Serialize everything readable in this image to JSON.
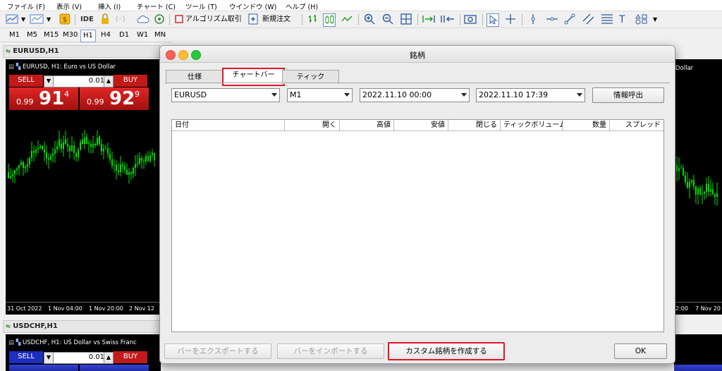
{
  "menu": [
    "ファイル (F)",
    "表示 (V)",
    "挿入 (I)",
    "チャート (C)",
    "ツール (T)",
    "ウインドウ (W)",
    "ヘルプ (H)"
  ],
  "toolbar": {
    "ide_label": "IDE",
    "algo_label": "アルゴリズム取引",
    "new_order_label": "新規注文"
  },
  "timeframes": [
    "M1",
    "M5",
    "M15",
    "M30",
    "H1",
    "H4",
    "D1",
    "W1",
    "MN"
  ],
  "active_timeframe": "H1",
  "charts": {
    "eurusd": {
      "window_title": "EURUSD,H1",
      "label": "EURUSD, H1:  Euro vs US Dollar",
      "sell": "SELL",
      "buy": "BUY",
      "lot": "0.01",
      "sell_small": "0.99",
      "sell_big": "91",
      "sell_sup": "4",
      "buy_small": "0.99",
      "buy_big": "92",
      "buy_sup": "9",
      "axis_left": [
        "31 Oct 2022",
        "1 Nov 04:00",
        "1 Nov 20:00",
        "2 Nov 12"
      ],
      "axis_right": [
        "2:00",
        "7 Nov 20"
      ],
      "right_label": "Dollar"
    },
    "usdchf": {
      "window_title": "USDCHF,H1",
      "label": "USDCHF, H1:  US Dollar vs Swiss Franc",
      "sell": "SELL",
      "buy": "BUY",
      "lot": "0.01"
    }
  },
  "dialog": {
    "title": "銘柄",
    "tabs": [
      "仕様",
      "チャートバー",
      "ティック"
    ],
    "active_tab": "チャートバー",
    "symbol": "EURUSD",
    "period": "M1",
    "date_from": "2022.11.10 00:00",
    "date_to": "2022.11.10 17:39",
    "request_button": "情報呼出",
    "columns": [
      "日付",
      "開く",
      "高値",
      "安値",
      "閉じる",
      "ティックボリューム",
      "数量",
      "スプレッド"
    ],
    "export_button": "バーをエクスポートする",
    "import_button": "バーをインポートする",
    "create_button": "カスタム銘柄を作成する",
    "ok_button": "OK"
  },
  "colors": {
    "highlight": "#e0152a",
    "candle": "#00e000",
    "sell": "#c21a1a",
    "buy_blue": "#1c2fc0"
  }
}
